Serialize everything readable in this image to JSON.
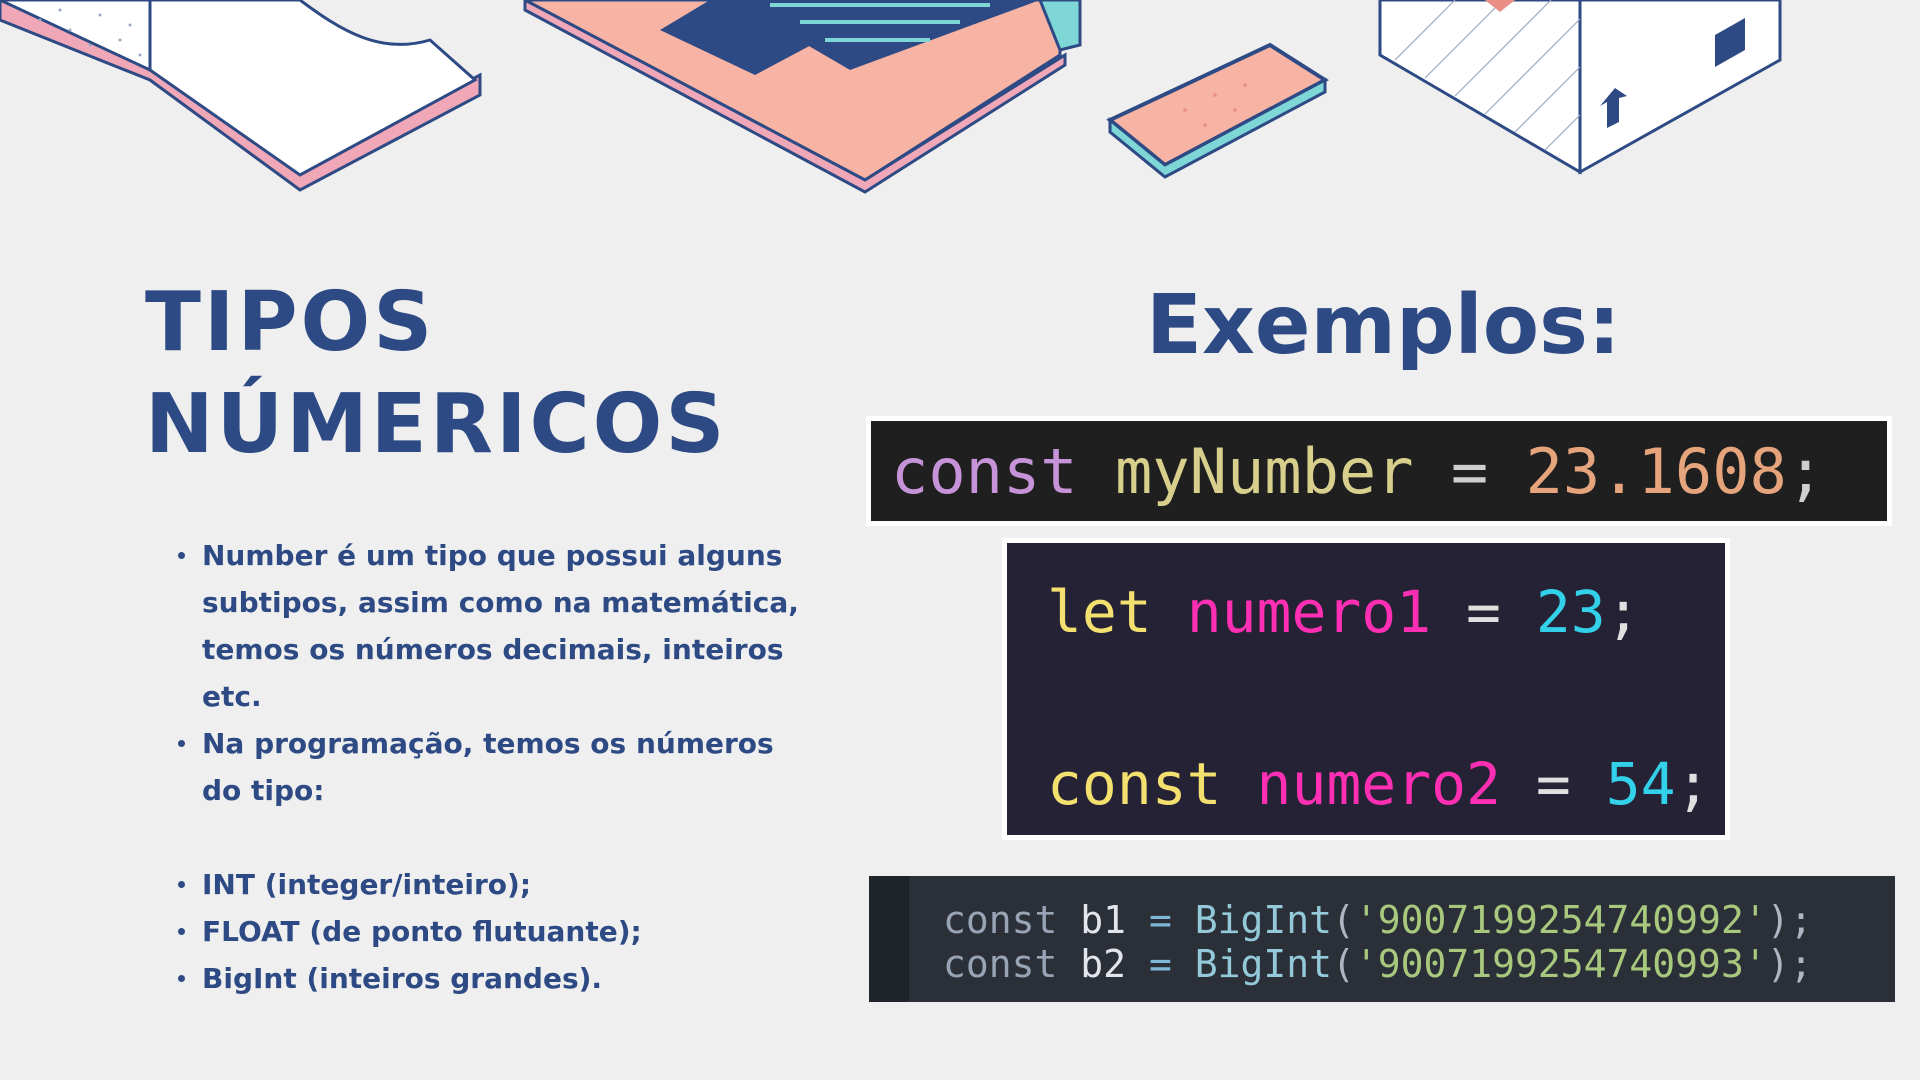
{
  "title": {
    "line1": "TIPOS",
    "line2": "NÚMERICOS"
  },
  "bullets": [
    "Number é um tipo que possui alguns subtipos, assim como na matemática, temos os números decimais, inteiros etc.",
    "Na programação, temos os números do tipo:",
    "INT (integer/inteiro);",
    "FLOAT (de ponto flutuante);",
    "BigInt (inteiros grandes)."
  ],
  "examples_heading": "Exemplos:",
  "code1": {
    "kw": "const",
    "var": "myNumber",
    "op": "=",
    "num": "23.1608",
    "end": ";"
  },
  "code2": [
    {
      "kw": "let",
      "var": "numero1",
      "op": "=",
      "num": "23",
      "end": ";"
    },
    {
      "kw": "const",
      "var": "numero2",
      "op": "=",
      "num": "54",
      "end": ";"
    }
  ],
  "code3": [
    {
      "kw": "const",
      "var": "b1",
      "op": "=",
      "fn": "BigInt",
      "str": "'9007199254740992'"
    },
    {
      "kw": "const",
      "var": "b2",
      "op": "=",
      "fn": "BigInt",
      "str": "'9007199254740993'"
    }
  ],
  "icons": [
    "open-book-icon",
    "laptop-icon",
    "smartphone-icon",
    "box-icon"
  ]
}
